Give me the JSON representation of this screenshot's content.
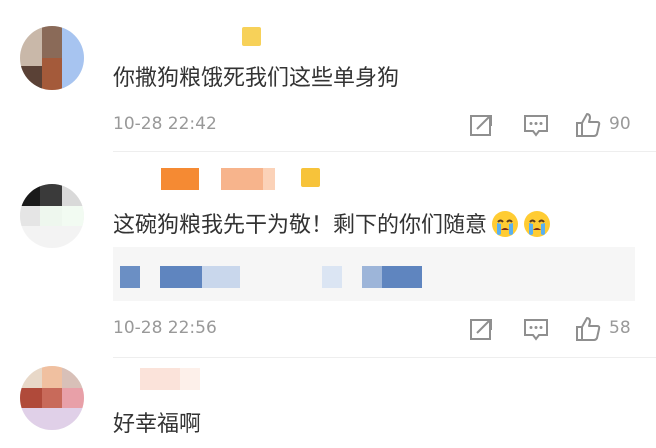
{
  "comments": [
    {
      "text": "你撒狗粮饿死我们这些单身狗",
      "time": "10-28 22:42",
      "likes": "90",
      "badge_color": "#f7d159"
    },
    {
      "text": "这碗狗粮我先干为敬！剩下的你们随意",
      "emoji": [
        "crying-face-icon",
        "crying-face-icon"
      ],
      "time": "10-28 22:56",
      "likes": "58",
      "badge_color": "#f7c33a"
    },
    {
      "text": "好幸福啊"
    }
  ],
  "colors": {
    "text": "#333333",
    "meta": "#999999",
    "reply_bg": "#f6f6f6",
    "icon": "#8f8f8f"
  }
}
